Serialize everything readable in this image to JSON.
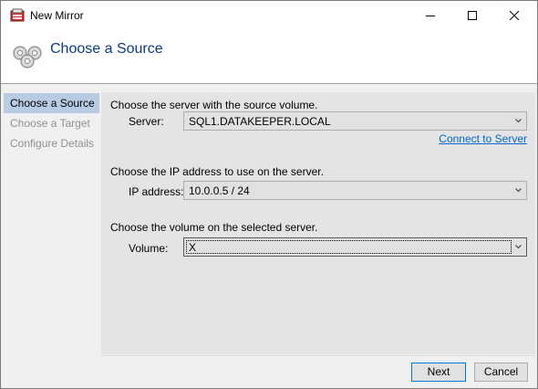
{
  "window": {
    "title": "New Mirror",
    "header_title": "Choose a Source"
  },
  "nav": {
    "items": [
      {
        "label": "Choose a Source",
        "active": true
      },
      {
        "label": "Choose a Target",
        "active": false
      },
      {
        "label": "Configure Details",
        "active": false
      }
    ]
  },
  "form": {
    "server_section": "Choose the server with the source volume.",
    "server_label": "Server:",
    "server_value": "SQL1.DATAKEEPER.LOCAL",
    "connect_link": "Connect to Server",
    "ip_section": "Choose the IP address to use on the server.",
    "ip_label": "IP address:",
    "ip_value": "10.0.0.5 / 24",
    "volume_section": "Choose the volume on the selected server.",
    "volume_label": "Volume:",
    "volume_value": "X"
  },
  "buttons": {
    "next": "Next",
    "cancel": "Cancel"
  },
  "colors": {
    "nav_active_bg": "#b7cbe3",
    "header_title": "#0e3a8a",
    "link": "#0066cc",
    "default_button_border": "#0078d7"
  },
  "icons": [
    "app-icon",
    "mirror-icon",
    "minimize-icon",
    "maximize-icon",
    "close-icon",
    "chevron-down-icon"
  ]
}
